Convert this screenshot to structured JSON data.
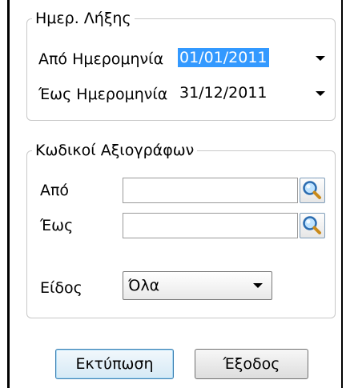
{
  "date_group": {
    "title": "Ημερ. Λήξης",
    "from_label": "Από Ημερομηνία",
    "from_value": "01/01/2011",
    "to_label": "Έως Ημερομηνία",
    "to_value": "31/12/2011"
  },
  "codes_group": {
    "title": "Κωδικοί Αξιογράφων",
    "from_label": "Από",
    "from_value": "",
    "to_label": "Έως",
    "to_value": "",
    "type_label": "Είδος",
    "type_value": "Όλα"
  },
  "buttons": {
    "print_label": "Εκτύπωση",
    "exit_label": "Έξοδος"
  },
  "icons": {
    "search_from": "magnifier-icon",
    "search_to": "magnifier-icon",
    "dropdown_arrow": "chevron-down-icon"
  },
  "colors": {
    "selection": "#3399ff",
    "default_button_border": "#3c7fb1"
  }
}
